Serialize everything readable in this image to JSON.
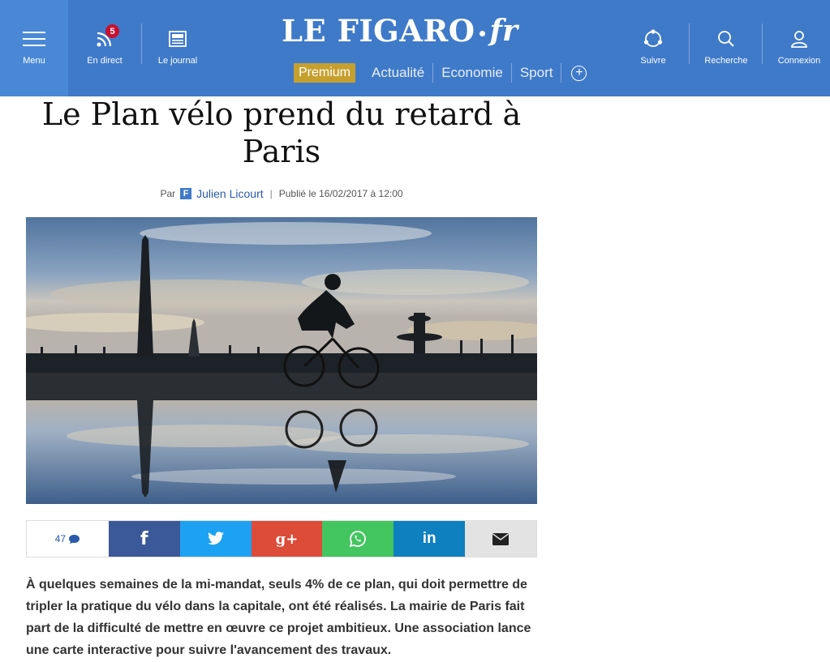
{
  "header": {
    "menu_label": "Menu",
    "live_label": "En direct",
    "live_badge": "5",
    "journal_label": "Le journal",
    "logo_main": "LE FIGARO",
    "logo_suffix": "fr",
    "follow_label": "Suivre",
    "search_label": "Recherche",
    "login_label": "Connexion",
    "nav": {
      "premium": "Premium",
      "items": [
        "Actualité",
        "Economie",
        "Sport"
      ],
      "more_symbol": "+"
    }
  },
  "article": {
    "title": "Le Plan vélo prend du retard à Paris",
    "byline_prefix": "Par",
    "author": "Julien Licourt",
    "separator": "|",
    "published": "Publié le 16/02/2017 à 12:00",
    "comment_count": "47",
    "share_labels": {
      "facebook": "f",
      "googleplus": "g+",
      "linkedin": "in"
    },
    "chapo": "À quelques semaines de la mi-mandat, seuls 4% de ce plan, qui doit permettre de tripler la pratique du vélo dans la capitale, ont été réalisés. La mairie de Paris fait part de la difficulté de mettre en œuvre ce projet ambitieux. Une association lance une carte interactive pour suivre l'avancement des travaux."
  },
  "colors": {
    "header_bg": "#3f7ac9",
    "premium_bg": "#c6a02f",
    "facebook": "#3b5998",
    "twitter": "#1da1f2",
    "googleplus": "#dd4b39",
    "whatsapp": "#43c55f",
    "linkedin": "#0e7fbf",
    "email": "#e3e3e3"
  }
}
